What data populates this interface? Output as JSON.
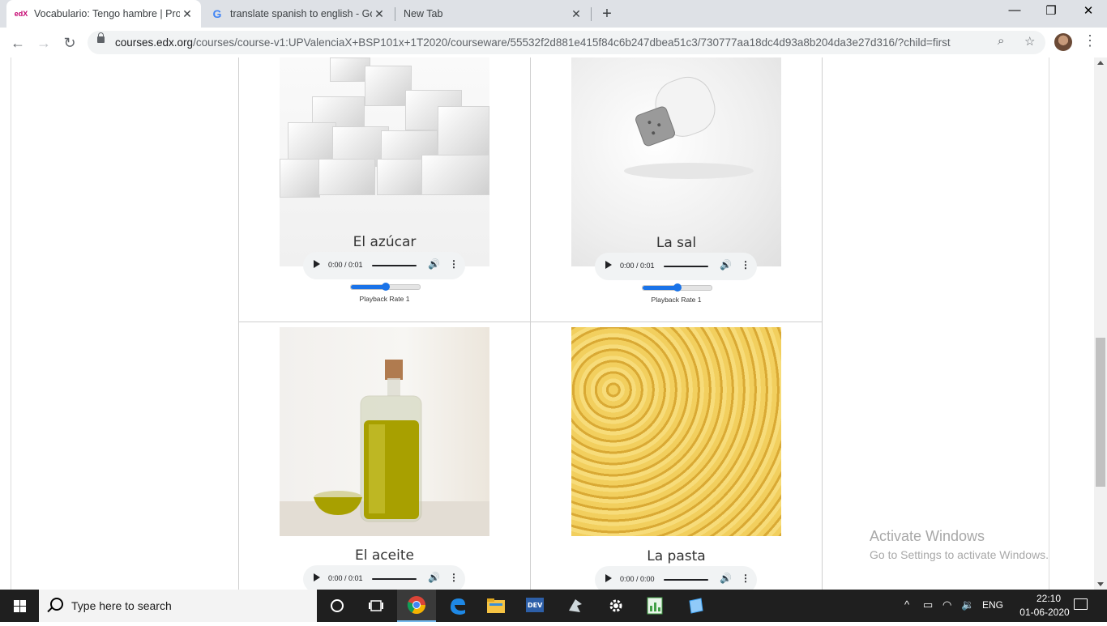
{
  "browser": {
    "tabs": [
      {
        "title": "Vocabulario: Tengo hambre | Pro",
        "favicon": "edx-icon",
        "favicon_text": "edX",
        "active": true
      },
      {
        "title": "translate spanish to english - Goo",
        "favicon": "google-icon",
        "favicon_text": "G",
        "active": false
      },
      {
        "title": "New Tab",
        "favicon": "",
        "favicon_text": "",
        "active": false
      }
    ],
    "new_tab_symbol": "+",
    "url_host": "courses.edx.org",
    "url_path": "/courses/course-v1:UPValenciaX+BSP101x+1T2020/courseware/55532f2d881e415f84c6b247dbea51c3/730777aa18dc4d93a8b204da3e27d316/?child=first",
    "window_controls": {
      "minimize": "—",
      "maximize": "❐",
      "close": "✕"
    }
  },
  "foods": [
    {
      "label": "El azúcar",
      "time": "0:00 / 0:01",
      "rate_label": "Playback Rate 1",
      "rate_fraction": 0.5,
      "show_rate": true
    },
    {
      "label": "La sal",
      "time": "0:00 / 0:01",
      "rate_label": "Playback Rate 1",
      "rate_fraction": 0.5,
      "show_rate": true
    },
    {
      "label": "El aceite",
      "time": "0:00 / 0:01",
      "show_rate": false
    },
    {
      "label": "La pasta",
      "time": "0:00 / 0:00",
      "show_rate": false
    }
  ],
  "watermark": {
    "title": "Activate Windows",
    "subtitle": "Go to Settings to activate Windows."
  },
  "taskbar": {
    "search_placeholder": "Type here to search",
    "pinned": [
      "cortana-icon",
      "task-view-icon",
      "chrome-icon",
      "edge-icon",
      "file-explorer-icon",
      "devcpp-icon",
      "app-icon",
      "settings-icon",
      "spreadsheet-icon",
      "notepad-icon"
    ],
    "language": "ENG",
    "time": "22:10",
    "date": "01-06-2020"
  }
}
